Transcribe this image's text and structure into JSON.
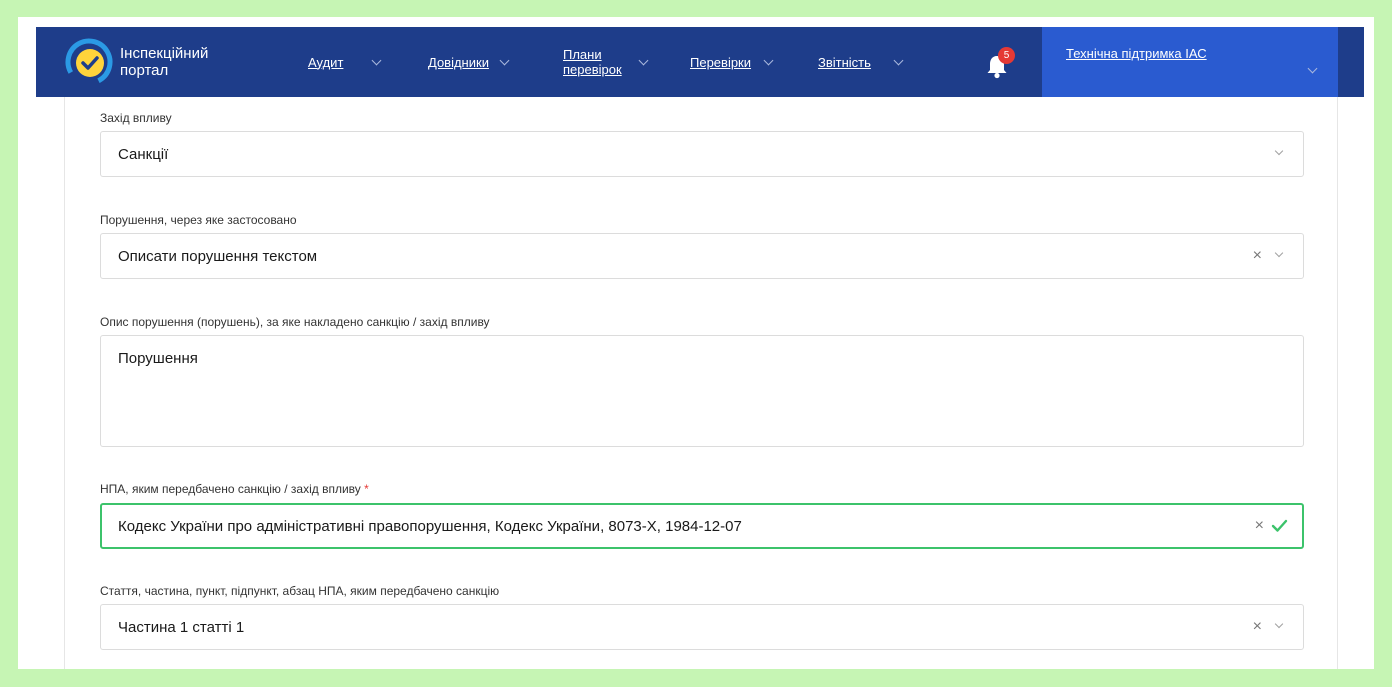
{
  "header": {
    "brand_line1": "Інспекційний",
    "brand_line2": "портал",
    "nav": {
      "audit": "Аудит",
      "directories": "Довідники",
      "plans_line1": "Плани",
      "plans_line2": "перевірок",
      "inspections": "Перевірки",
      "reports": "Звітність"
    },
    "notifications_count": "5",
    "support": "Технічна підтримка ІАС",
    "colors": {
      "navbar": "#1e3d8a",
      "support_bg": "#2a5bd0",
      "badge": "#e53935"
    }
  },
  "form": {
    "measure": {
      "label": "Захід впливу",
      "value": "Санкції"
    },
    "violation": {
      "label": "Порушення, через яке застосовано",
      "value": "Описати порушення текстом"
    },
    "description": {
      "label": "Опис порушення (порушень), за яке накладено санкцію / захід впливу",
      "value": "Порушення"
    },
    "legal_act": {
      "label": "НПА, яким передбачено санкцію / захід впливу",
      "required_mark": "*",
      "value": "Кодекс України про адміністративні правопорушення, Кодекс України, 8073-X, 1984-12-07"
    },
    "article": {
      "label": "Стаття, частина, пункт, підпункт, абзац НПА, яким передбачено санкцію",
      "value": "Частина 1 статті 1"
    },
    "clear_symbol": "×",
    "colors": {
      "valid_border": "#3cc36b",
      "required": "#e53935"
    }
  }
}
